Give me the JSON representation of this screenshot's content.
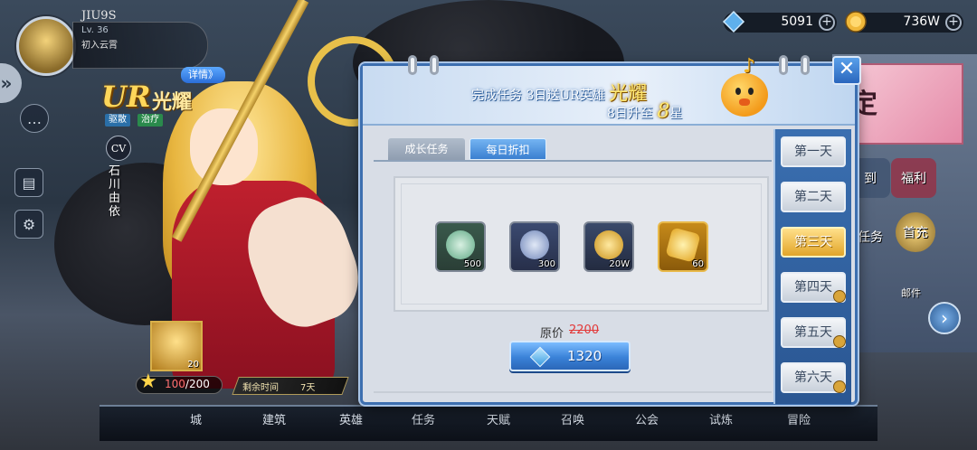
{
  "player": {
    "name": "JIU9S",
    "level": "Lv. 36",
    "title": "初入云霄"
  },
  "currencies": [
    {
      "value": "5091",
      "icon": "diamond-icon"
    },
    {
      "value": "736W",
      "icon": "gold-coin-icon"
    }
  ],
  "hero": {
    "rarity": "UR",
    "name": "光耀",
    "details_label": "详情》",
    "tags": [
      "驱散",
      "治疗"
    ],
    "cv_label": "CV",
    "voice_actor": "石川由依",
    "fragment_count": "20",
    "progress_current": "100",
    "progress_total": "/200",
    "timer_label": "剩余时间",
    "timer_value": "7天"
  },
  "bottom_nav": [
    "城",
    "建筑",
    "英雄",
    "任务",
    "天赋",
    "召唤",
    "公会",
    "试炼",
    "冒险"
  ],
  "right_menu": {
    "sign_text": "定",
    "sign_in": "到",
    "welfare": "福利",
    "task_text": "任务",
    "first_charge": "首充",
    "mail": "邮件"
  },
  "modal": {
    "header_line1_prefix": "完成任务 3日送UR英雄 ",
    "header_line1_hero": "光耀",
    "header_line2_prefix": "8日升至 ",
    "header_line2_value": "8",
    "header_line2_suffix": "星",
    "tabs": [
      "成长任务",
      "每日折扣"
    ],
    "active_tab": "每日折扣",
    "items": [
      {
        "icon": "green-badge-icon",
        "qty": "500"
      },
      {
        "icon": "blue-badge-icon",
        "qty": "300"
      },
      {
        "icon": "gold-coin-icon",
        "qty": "20W"
      },
      {
        "icon": "gold-star-icon",
        "qty": "60"
      }
    ],
    "orig_label": "原价",
    "orig_price": "2200",
    "price": "1320",
    "days": [
      "第一天",
      "第二天",
      "第三天",
      "第四天",
      "第五天",
      "第六天"
    ],
    "active_day": "第三天"
  },
  "colors": {
    "accent": "#3a82d8",
    "gold": "#ffe770",
    "strike": "#e23a3a"
  }
}
